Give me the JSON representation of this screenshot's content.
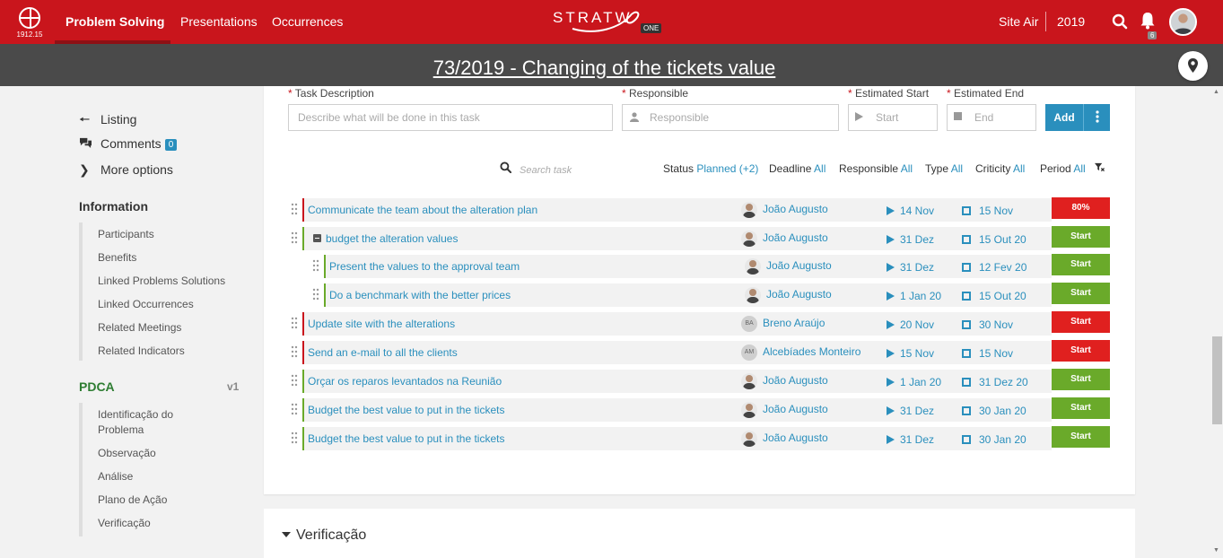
{
  "topbar": {
    "logo_text": "1912.15",
    "nav": [
      "Problem Solving",
      "Presentations",
      "Occurrences"
    ],
    "brand": "STRATW",
    "brand_badge": "ONE",
    "site": "Site Air",
    "year": "2019",
    "notifications": "6",
    "colors": {
      "bar": "#c9151c"
    }
  },
  "banner": {
    "title": "73/2019 - Changing of the tickets value"
  },
  "sidebar": {
    "listing": "Listing",
    "comments": "Comments",
    "comments_count": "0",
    "more_options": "More options",
    "information_title": "Information",
    "information_items": [
      "Participants",
      "Benefits",
      "Linked Problems Solutions",
      "Linked Occurrences",
      "Related Meetings",
      "Related Indicators"
    ],
    "pdca_title": "PDCA",
    "pdca_version": "v1",
    "pdca_items": [
      "Identificação do Problema",
      "Observação",
      "Análise",
      "Plano de Ação",
      "Verificação"
    ]
  },
  "form": {
    "task_label": "Task Description",
    "task_placeholder": "Describe what will be done in this task",
    "responsible_label": "Responsible",
    "responsible_placeholder": "Responsible",
    "start_label": "Estimated Start",
    "start_placeholder": "Start",
    "end_label": "Estimated End",
    "end_placeholder": "End",
    "add_button": "Add",
    "required_mark": "*"
  },
  "filters": {
    "search_placeholder": "Search task",
    "status_label": "Status",
    "status_value": "Planned (+2)",
    "deadline_label": "Deadline",
    "deadline_value": "All",
    "responsible_label": "Responsible",
    "responsible_value": "All",
    "type_label": "Type",
    "type_value": "All",
    "criticity_label": "Criticity",
    "criticity_value": "All",
    "period_label": "Period",
    "period_value": "All"
  },
  "tasks": [
    {
      "title": "Communicate the team about the alteration plan",
      "person": "João Augusto",
      "avatar": "photo",
      "start": "14 Nov",
      "end": "15 Nov",
      "status": "80%",
      "bar_color": "#c9151c",
      "status_color": "#e0201f",
      "level": 0
    },
    {
      "title": "budget the alteration values",
      "person": "João Augusto",
      "avatar": "photo",
      "start": "31 Dez",
      "end": "15 Out 20",
      "status": "Start",
      "bar_color": "#6aaa2a",
      "status_color": "#6aaa2a",
      "level": 0,
      "collapsible": true
    },
    {
      "title": "Present the values to the approval team",
      "person": "João Augusto",
      "avatar": "photo",
      "start": "31 Dez",
      "end": "12 Fev 20",
      "status": "Start",
      "bar_color": "#6aaa2a",
      "status_color": "#6aaa2a",
      "level": 1
    },
    {
      "title": "Do a benchmark with the better prices",
      "person": "João Augusto",
      "avatar": "photo",
      "start": "1 Jan 20",
      "end": "15 Out 20",
      "status": "Start",
      "bar_color": "#6aaa2a",
      "status_color": "#6aaa2a",
      "level": 1
    },
    {
      "title": "Update site with the alterations",
      "person": "Breno Araújo",
      "avatar": "BA",
      "start": "20 Nov",
      "end": "30 Nov",
      "status": "Start",
      "bar_color": "#c9151c",
      "status_color": "#e0201f",
      "level": 0
    },
    {
      "title": "Send an e-mail to all the clients",
      "person": "Alcebíades Monteiro",
      "avatar": "AM",
      "start": "15 Nov",
      "end": "15 Nov",
      "status": "Start",
      "bar_color": "#c9151c",
      "status_color": "#e0201f",
      "level": 0
    },
    {
      "title": "Orçar os reparos levantados na Reunião",
      "person": "João Augusto",
      "avatar": "photo",
      "start": "1 Jan 20",
      "end": "31 Dez 20",
      "status": "Start",
      "bar_color": "#6aaa2a",
      "status_color": "#6aaa2a",
      "level": 0
    },
    {
      "title": "Budget the best value to put in the tickets",
      "person": "João Augusto",
      "avatar": "photo",
      "start": "31 Dez",
      "end": "30 Jan 20",
      "status": "Start",
      "bar_color": "#6aaa2a",
      "status_color": "#6aaa2a",
      "level": 0
    },
    {
      "title": "Budget the best value to put in the tickets",
      "person": "João Augusto",
      "avatar": "photo",
      "start": "31 Dez",
      "end": "30 Jan 20",
      "status": "Start",
      "bar_color": "#6aaa2a",
      "status_color": "#6aaa2a",
      "level": 0
    }
  ],
  "section2": {
    "title": "Verificação"
  }
}
